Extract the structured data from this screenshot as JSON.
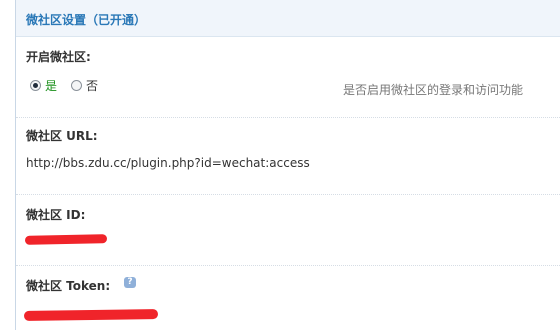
{
  "header": {
    "title": "微社区设置（已开通）"
  },
  "open_community": {
    "label": "开启微社区:",
    "options": [
      {
        "label": "是",
        "selected": true
      },
      {
        "label": "否",
        "selected": false
      }
    ],
    "description": "是否启用微社区的登录和访问功能"
  },
  "community_url": {
    "label": "微社区 URL:",
    "value": "http://bbs.zdu.cc/plugin.php?id=wechat:access"
  },
  "community_id": {
    "label": "微社区 ID:",
    "value_redacted": true
  },
  "community_token": {
    "label": "微社区 Token:",
    "help_icon": "question-help-icon",
    "value_redacted": true
  },
  "colors": {
    "title": "#2a78b7",
    "selected_option": "#1a8f1a",
    "redaction": "#f0242a",
    "header_bg": "#f0f5fb"
  }
}
